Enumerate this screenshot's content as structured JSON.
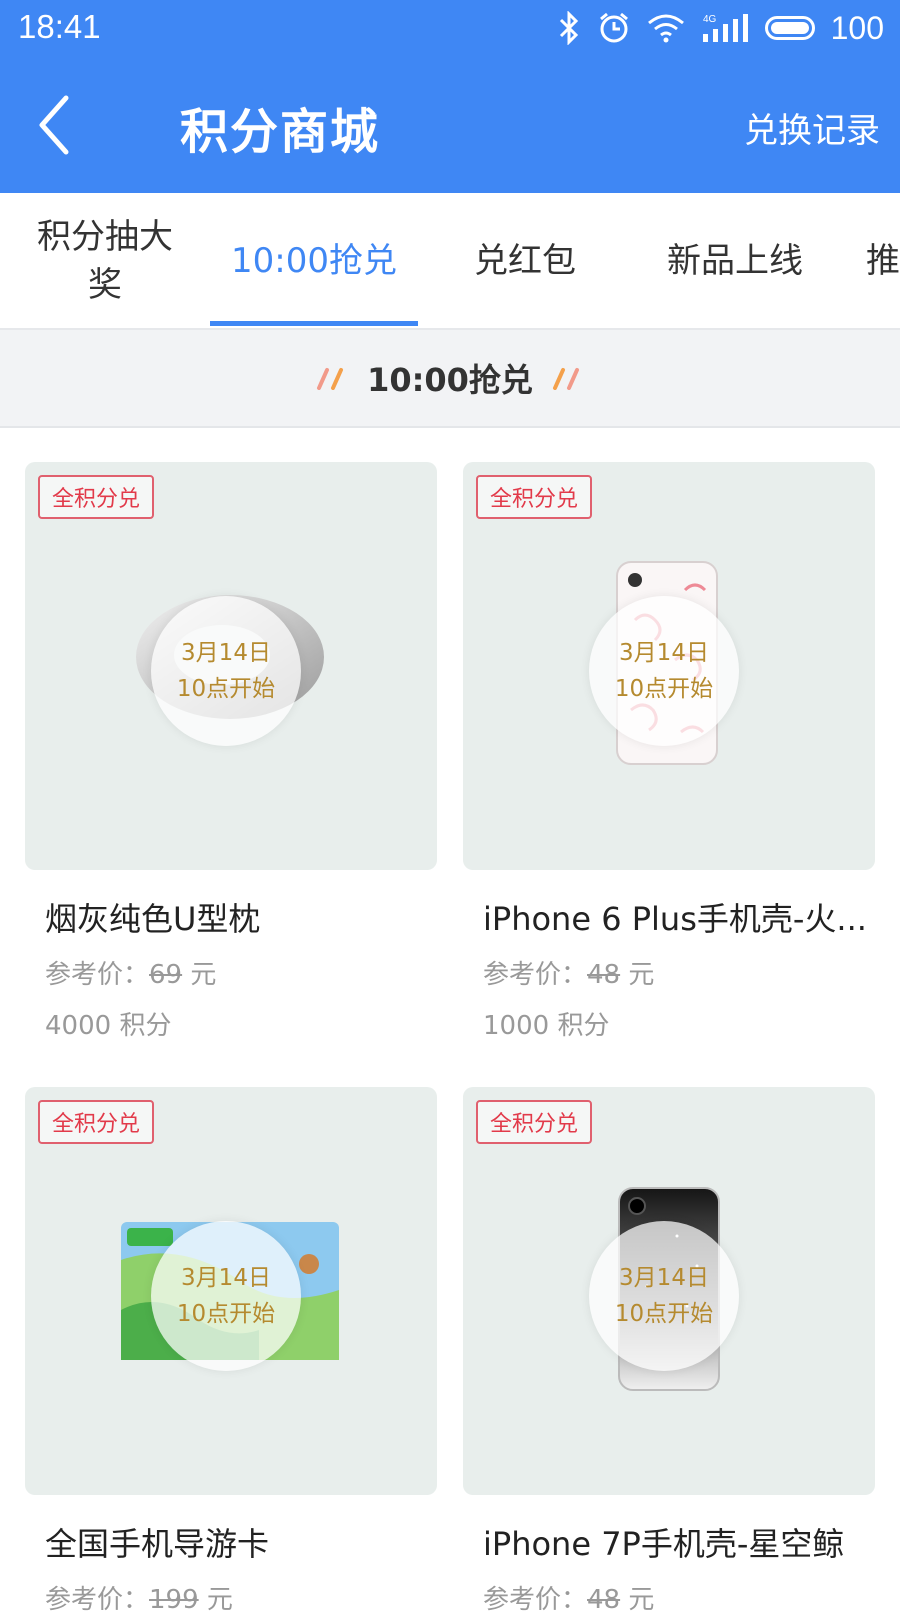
{
  "status_bar": {
    "time": "18:41",
    "battery": "100",
    "network": "4G"
  },
  "header": {
    "title": "积分商城",
    "right_link": "兑换记录"
  },
  "tabs": [
    {
      "label": "积分抽大奖"
    },
    {
      "label": "10:00抢兑"
    },
    {
      "label": "兑红包"
    },
    {
      "label": "新品上线"
    },
    {
      "label": "推"
    }
  ],
  "active_tab": "10:00抢兑",
  "section": {
    "title": "10:00抢兑"
  },
  "products": [
    {
      "badge": "全积分兑",
      "overlay_date": "3月14日",
      "overlay_time": "10点开始",
      "name": "烟灰纯色U型枕",
      "price_label": "参考价：",
      "price": "69",
      "price_unit": "元",
      "points": "4000",
      "points_unit": "积分"
    },
    {
      "badge": "全积分兑",
      "overlay_date": "3月14日",
      "overlay_time": "10点开始",
      "name": "iPhone 6 Plus手机壳-火...",
      "price_label": "参考价：",
      "price": "48",
      "price_unit": "元",
      "points": "1000",
      "points_unit": "积分"
    },
    {
      "badge": "全积分兑",
      "overlay_date": "3月14日",
      "overlay_time": "10点开始",
      "name": "全国手机导游卡",
      "price_label": "参考价：",
      "price": "199",
      "price_unit": "元",
      "points": "",
      "points_unit": ""
    },
    {
      "badge": "全积分兑",
      "overlay_date": "3月14日",
      "overlay_time": "10点开始",
      "name": "iPhone 7P手机壳-星空鲸",
      "price_label": "参考价：",
      "price": "48",
      "price_unit": "元",
      "points": "",
      "points_unit": ""
    }
  ],
  "colors": {
    "primary": "#3f87f4",
    "badge": "#e23a4a",
    "overlay_text": "#b58a2f",
    "card_bg": "#e8eeec"
  }
}
